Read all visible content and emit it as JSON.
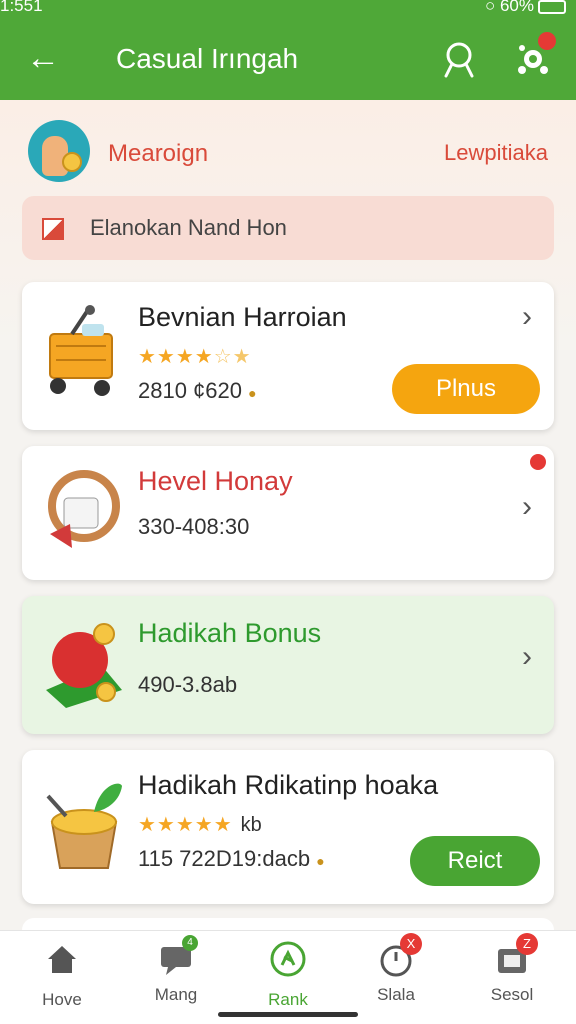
{
  "status": {
    "time": "1:551",
    "battery": "60%"
  },
  "header": {
    "title": "Casual Irıngah"
  },
  "promo": {
    "name": "Mearoign",
    "link": "Lewpitiaka"
  },
  "notice": {
    "text": "Elanokan Nand Hon"
  },
  "cards": [
    {
      "title": "Bevnian Harroian",
      "rating": 4,
      "sub": "2810 ¢620",
      "button": "Plnus"
    },
    {
      "title": "Hevel Honay",
      "sub": "330-408:30"
    },
    {
      "title": "Hadikah Bonus",
      "sub": "490-3.8ab"
    },
    {
      "title": "Hadikah Rdikatinp hoaka",
      "rating": 5,
      "rating_note": "kb",
      "sub": "115 722D19:dacb",
      "button": "Reict"
    }
  ],
  "nav": [
    {
      "label": "Hove",
      "icon": "home-icon"
    },
    {
      "label": "Mang",
      "icon": "chat-icon",
      "badge": "4"
    },
    {
      "label": "Rank",
      "icon": "rank-icon"
    },
    {
      "label": "Slala",
      "icon": "timer-icon",
      "badge": "X"
    },
    {
      "label": "Sesol",
      "icon": "bag-icon",
      "badge": "Z"
    }
  ],
  "colors": {
    "brand": "#4fa838",
    "accent_orange": "#f5a50f",
    "alert_red": "#e53935",
    "title_red": "#d23a3a"
  }
}
